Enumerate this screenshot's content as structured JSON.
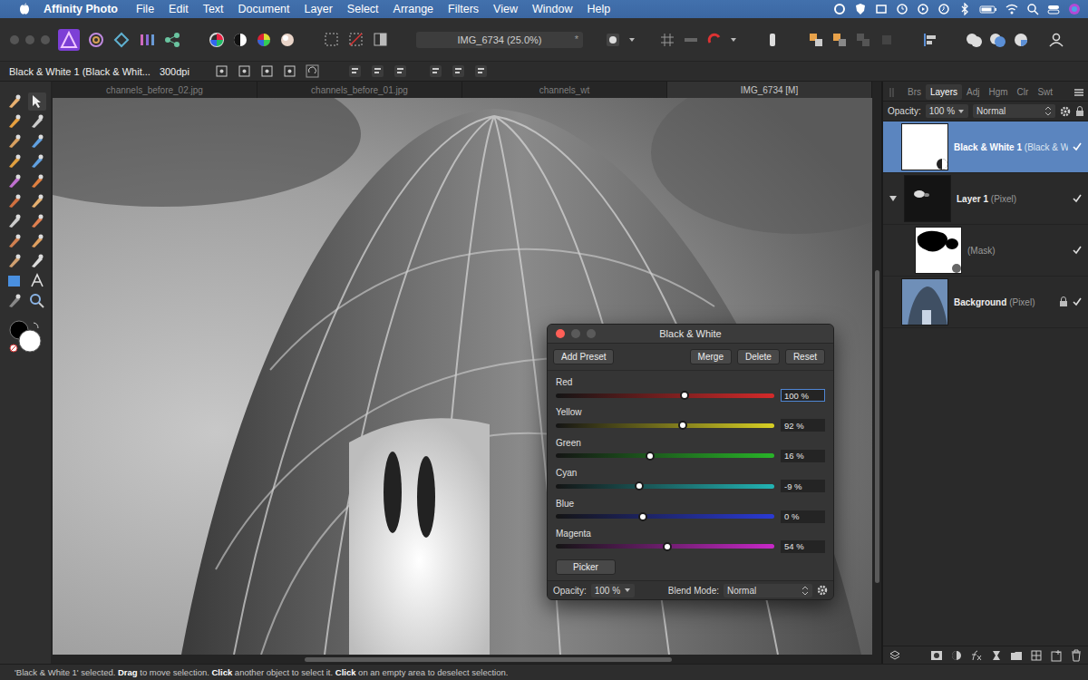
{
  "menubar": {
    "app": "Affinity Photo",
    "items": [
      "File",
      "Edit",
      "Text",
      "Document",
      "Layer",
      "Select",
      "Arrange",
      "Filters",
      "View",
      "Window",
      "Help"
    ]
  },
  "toolbar": {
    "document": "IMG_6734 (25.0%)",
    "modified": "*"
  },
  "context_bar": {
    "selection": "Black & White 1 (Black & Whit...",
    "dpi": "300dpi"
  },
  "document_tabs": [
    {
      "label": "channels_before_02.jpg",
      "selected": false
    },
    {
      "label": "channels_before_01.jpg",
      "selected": false
    },
    {
      "label": "channels_wt",
      "selected": false
    },
    {
      "label": "IMG_6734 [M]",
      "selected": true
    }
  ],
  "panel_tabs": [
    {
      "label": "Brs",
      "selected": false
    },
    {
      "label": "Layers",
      "selected": true
    },
    {
      "label": "Adj",
      "selected": false
    },
    {
      "label": "Hgm",
      "selected": false
    },
    {
      "label": "Clr",
      "selected": false
    },
    {
      "label": "Swt",
      "selected": false
    }
  ],
  "layers": {
    "opacity_label": "Opacity:",
    "opacity": "100 %",
    "blend_mode": "Normal",
    "items": [
      {
        "name": "Black & White 1",
        "type": "(Black & W",
        "kind": "adjustment",
        "selected": true,
        "visible": true
      },
      {
        "name": "Layer 1",
        "type": "(Pixel)",
        "kind": "pixel",
        "selected": false,
        "visible": true,
        "expanded": true
      },
      {
        "type": "(Mask)",
        "kind": "mask",
        "selected": false,
        "visible": true
      },
      {
        "name": "Background",
        "type": "(Pixel)",
        "kind": "photo",
        "selected": false,
        "visible": true,
        "locked": true
      }
    ]
  },
  "dialog": {
    "title": "Black & White",
    "buttons": [
      "Add Preset",
      "Merge",
      "Delete",
      "Reset"
    ],
    "sliders": [
      {
        "label": "Red",
        "value": "100 %",
        "level": 0.59,
        "color": "#d42a2a",
        "focused": true
      },
      {
        "label": "Yellow",
        "value": "92 %",
        "level": 0.58,
        "color": "#d8d024",
        "focused": false
      },
      {
        "label": "Green",
        "value": "16 %",
        "level": 0.43,
        "color": "#28b428",
        "focused": false
      },
      {
        "label": "Cyan",
        "value": "-9 %",
        "level": 0.38,
        "color": "#22b4b4",
        "focused": false
      },
      {
        "label": "Blue",
        "value": "0 %",
        "level": 0.4,
        "color": "#2a3ad4",
        "focused": false
      },
      {
        "label": "Magenta",
        "value": "54 %",
        "level": 0.51,
        "color": "#c828c8",
        "focused": false
      }
    ],
    "picker": "Picker",
    "opacity_label": "Opacity:",
    "opacity": "100 %",
    "blend_label": "Blend Mode:",
    "blend_mode": "Normal"
  },
  "status_bar": {
    "segments": [
      {
        "text": "'Black & White 1' selected. ",
        "bold": false
      },
      {
        "text": "Drag",
        "bold": true
      },
      {
        "text": " to move selection. ",
        "bold": false
      },
      {
        "text": "Click",
        "bold": true
      },
      {
        "text": " another object to select it. ",
        "bold": false
      },
      {
        "text": "Click",
        "bold": true
      },
      {
        "text": " on an empty area to deselect selection.",
        "bold": false
      }
    ]
  }
}
